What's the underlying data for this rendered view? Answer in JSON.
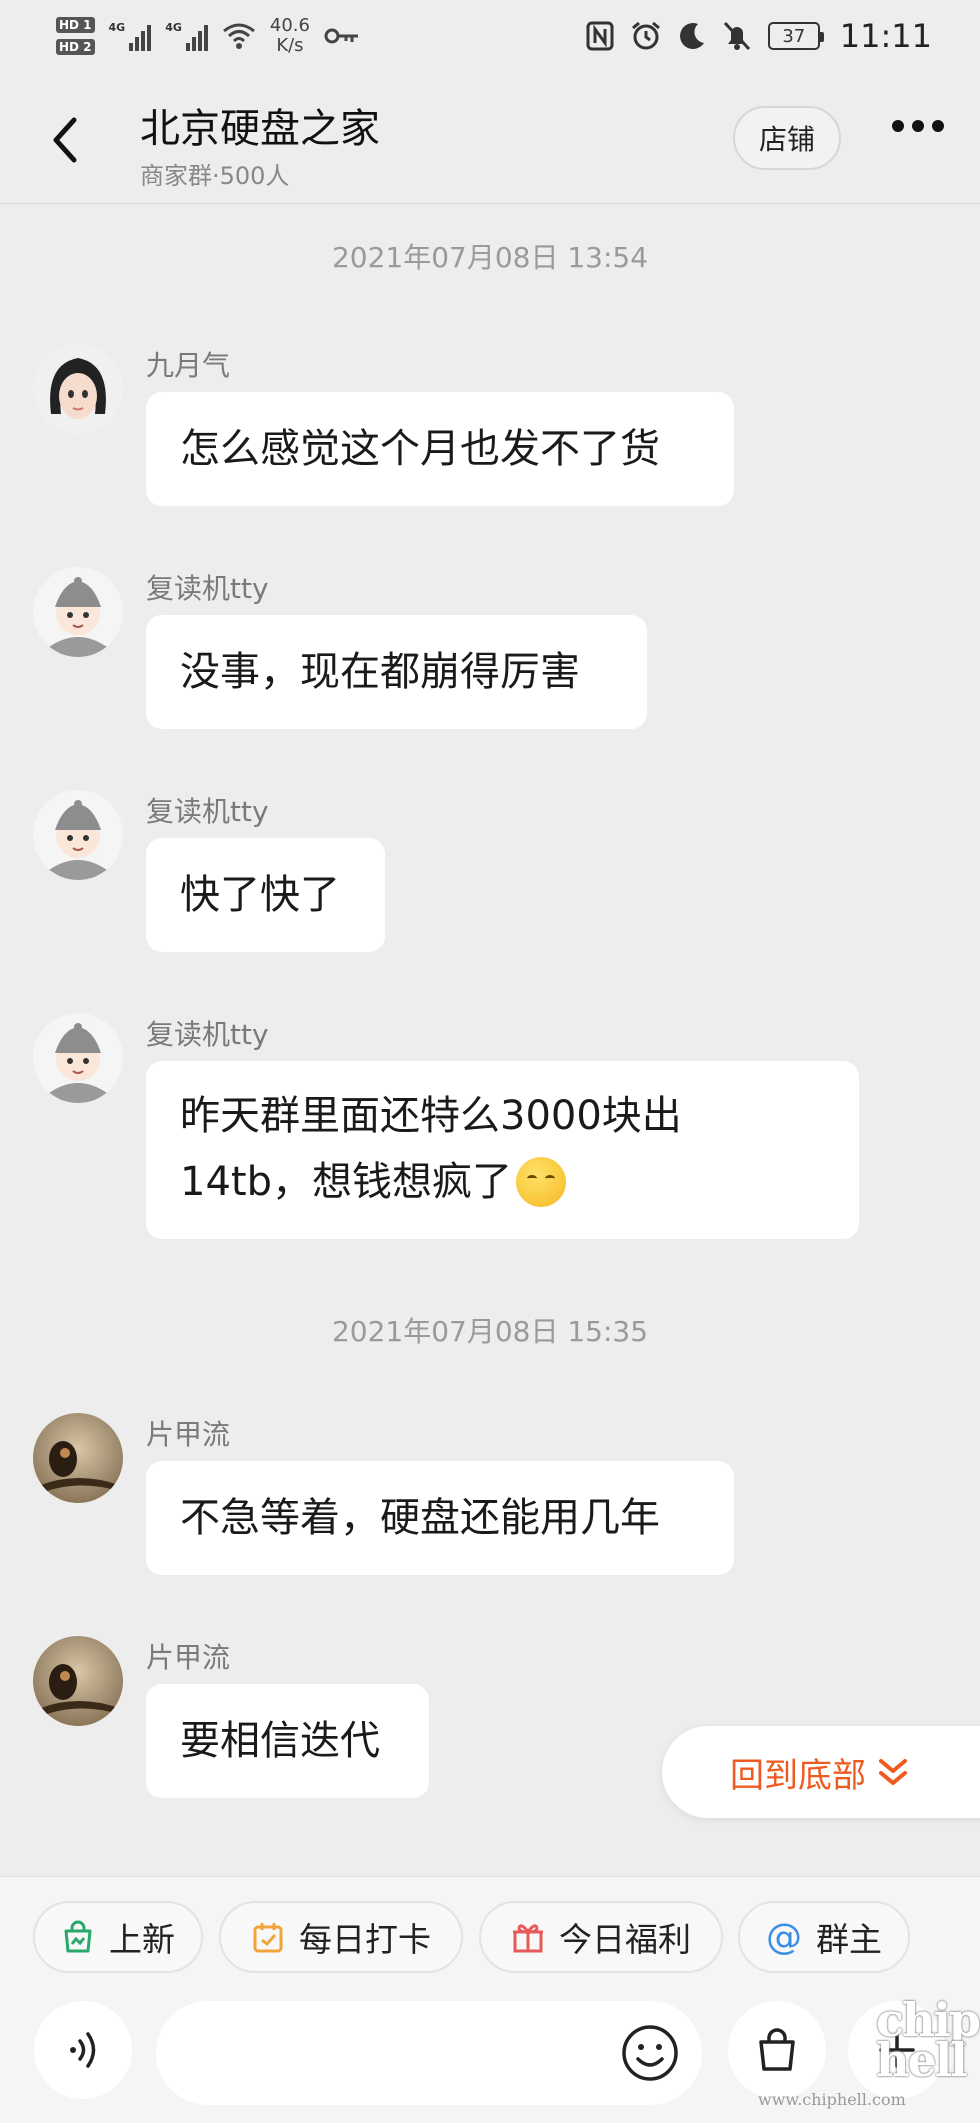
{
  "status_bar": {
    "hd1": "HD 1",
    "hd2": "HD 2",
    "net1": "4G",
    "net2": "4G",
    "speed_value": "40.6",
    "speed_unit": "K/s",
    "battery": "37",
    "time": "11:11"
  },
  "header": {
    "title": "北京硬盘之家",
    "subtitle": "商家群·500人",
    "shop_button": "店铺"
  },
  "timestamps": [
    "2021年07月08日 13:54",
    "2021年07月08日 15:35"
  ],
  "messages": [
    {
      "sender": "九月气",
      "text": "怎么感觉这个月也发不了货"
    },
    {
      "sender": "复读机tty",
      "text": "没事，现在都崩得厉害"
    },
    {
      "sender": "复读机tty",
      "text": "快了快了"
    },
    {
      "sender": "复读机tty",
      "line1": "昨天群里面还特么3000块出",
      "line2": "14tb，想钱想疯了"
    },
    {
      "sender": "片甲流",
      "text": "不急等着，硬盘还能用几年"
    },
    {
      "sender": "片甲流",
      "text": "要相信迭代"
    }
  ],
  "back_to_bottom": "回到底部",
  "quick_actions": [
    "上新",
    "每日打卡",
    "今日福利",
    "群主"
  ],
  "input": {
    "placeholder": ""
  },
  "watermark": {
    "logo": "chip hell",
    "url": "www.chiphell.com"
  },
  "colors": {
    "accent": "#ee5a1f",
    "background": "#ededed",
    "bubble": "#ffffff"
  }
}
